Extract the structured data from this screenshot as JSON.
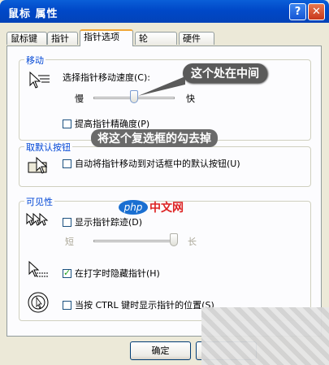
{
  "window": {
    "title": "鼠标 属性",
    "help_label": "?",
    "close_label": "✕"
  },
  "tabs": [
    {
      "label": "鼠标键"
    },
    {
      "label": "指针"
    },
    {
      "label": "指针选项"
    },
    {
      "label": "轮"
    },
    {
      "label": "硬件"
    }
  ],
  "motion": {
    "group_label": "移动",
    "speed_label": "选择指针移动速度(C):",
    "slow_label": "慢",
    "fast_label": "快",
    "speed_value": 0.5,
    "enhance_label": "提高指针精确度(P)",
    "enhance_checked": false
  },
  "snap": {
    "group_label": "取默认按钮",
    "snap_label": "自动将指针移动到对话框中的默认按钮(U)",
    "snap_checked": false
  },
  "visibility": {
    "group_label": "可见性",
    "trails_label": "显示指针踪迹(D)",
    "trails_checked": false,
    "short_label": "短",
    "long_label": "长",
    "trail_value": 0.95,
    "hide_label": "在打字时隐藏指针(H)",
    "hide_checked": true,
    "ctrl_label": "当按 CTRL 键时显示指针的位置(S)",
    "ctrl_checked": false
  },
  "annotations": {
    "callout_middle": "这个处在中间",
    "callout_uncheck": "将这个复选框的勾去掉"
  },
  "watermark": {
    "logo": "php",
    "text": "中文网"
  },
  "buttons": {
    "ok_label": "确定"
  }
}
